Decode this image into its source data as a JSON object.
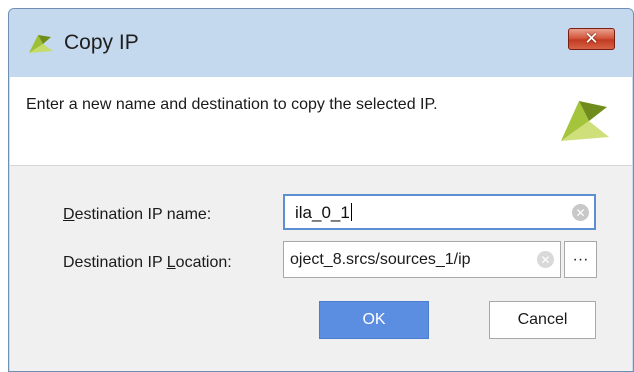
{
  "window": {
    "title": "Copy IP",
    "close_glyph": "✕",
    "title_icon": "vivado-logo-icon",
    "close_icon": "close-icon"
  },
  "header": {
    "description": "Enter a new name and destination to copy the selected IP.",
    "logo_icon": "vivado-logo-icon"
  },
  "form": {
    "name_label_prefix": "D",
    "name_label_rest": "estination IP name:",
    "name_value": "ila_0_1",
    "loc_label_prefix": "Destination IP ",
    "loc_label_underlined": "L",
    "loc_label_rest": "ocation:",
    "loc_value": "oject_8.srcs/sources_1/ip",
    "browse_label": "···",
    "clear_glyph": "✕"
  },
  "buttons": {
    "ok": "OK",
    "cancel": "Cancel"
  },
  "colors": {
    "accent": "#5b8ee0",
    "logo_green": "#8fb624",
    "logo_dark": "#6f8c1c",
    "close_red": "#c23b22"
  }
}
